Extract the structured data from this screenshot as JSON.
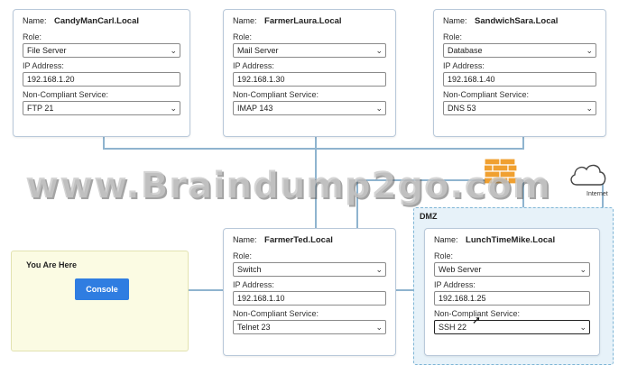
{
  "labels": {
    "name": "Name:",
    "role": "Role:",
    "ip": "IP Address:",
    "service": "Non-Compliant Service:"
  },
  "servers": [
    {
      "name": "CandyManCarl.Local",
      "role": "File Server",
      "ip": "192.168.1.20",
      "service": "FTP 21"
    },
    {
      "name": "FarmerLaura.Local",
      "role": "Mail Server",
      "ip": "192.168.1.30",
      "service": "IMAP 143"
    },
    {
      "name": "SandwichSara.Local",
      "role": "Database",
      "ip": "192.168.1.40",
      "service": "DNS 53"
    },
    {
      "name": "FarmerTed.Local",
      "role": "Switch",
      "ip": "192.168.1.10",
      "service": "Telnet 23"
    },
    {
      "name": "LunchTimeMike.Local",
      "role": "Web Server",
      "ip": "192.168.1.25",
      "service": "SSH 22"
    }
  ],
  "dmz": {
    "label": "DMZ"
  },
  "you_are_here": {
    "label": "You Are Here",
    "button": "Console"
  },
  "internet": {
    "label": "Internet"
  },
  "watermark": "www.Braindump2go.com",
  "colors": {
    "accent": "#2f7de1",
    "connector": "#8fb4cf",
    "firewall": "#f0a030",
    "dmz_fill": "#e7f2f9"
  }
}
